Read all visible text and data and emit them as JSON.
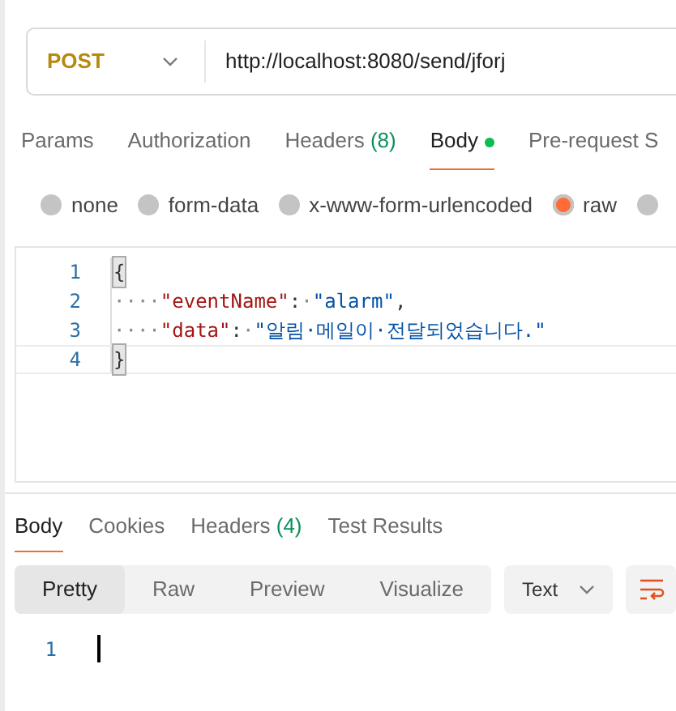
{
  "request": {
    "method": "POST",
    "url": "http://localhost:8080/send/jforj"
  },
  "request_tabs": [
    {
      "label": "Params",
      "selected": false,
      "dot": false
    },
    {
      "label": "Authorization",
      "selected": false,
      "dot": false
    },
    {
      "label": "Headers",
      "count": "(8)",
      "selected": false,
      "dot": false
    },
    {
      "label": "Body",
      "selected": true,
      "dot": true
    },
    {
      "label": "Pre-request S",
      "selected": false,
      "dot": false
    }
  ],
  "body_types": [
    {
      "label": "none",
      "selected": false
    },
    {
      "label": "form-data",
      "selected": false
    },
    {
      "label": "x-www-form-urlencoded",
      "selected": false
    },
    {
      "label": "raw",
      "selected": true
    },
    {
      "selected": false
    }
  ],
  "editor": {
    "lines": [
      {
        "number": "1",
        "current": false,
        "tokens": [
          {
            "kind": "brace",
            "text": "{",
            "matched": true
          }
        ]
      },
      {
        "number": "2",
        "current": false,
        "tokens": [
          {
            "kind": "ws",
            "text": "····"
          },
          {
            "kind": "key",
            "text": "\"eventName\""
          },
          {
            "kind": "punct",
            "text": ":"
          },
          {
            "kind": "ws",
            "text": "·"
          },
          {
            "kind": "string",
            "text": "\"alarm\""
          },
          {
            "kind": "punct",
            "text": ","
          }
        ]
      },
      {
        "number": "3",
        "current": false,
        "tokens": [
          {
            "kind": "ws",
            "text": "····"
          },
          {
            "kind": "key",
            "text": "\"data\""
          },
          {
            "kind": "punct",
            "text": ":"
          },
          {
            "kind": "ws",
            "text": "·"
          },
          {
            "kind": "string",
            "text": "\"알림·메일이·전달되었습니다.\""
          }
        ]
      },
      {
        "number": "4",
        "current": true,
        "tokens": [
          {
            "kind": "brace",
            "text": "}",
            "matched": true
          }
        ]
      }
    ]
  },
  "response_tabs": [
    {
      "label": "Body",
      "selected": true
    },
    {
      "label": "Cookies",
      "selected": false
    },
    {
      "label": "Headers",
      "count": "(4)",
      "selected": false
    },
    {
      "label": "Test Results",
      "selected": false
    }
  ],
  "view_modes": [
    {
      "label": "Pretty",
      "selected": true
    },
    {
      "label": "Raw",
      "selected": false
    },
    {
      "label": "Preview",
      "selected": false
    },
    {
      "label": "Visualize",
      "selected": false
    }
  ],
  "format": "Text",
  "response_editor": {
    "lines": [
      {
        "number": "1",
        "cursor": true
      }
    ]
  }
}
